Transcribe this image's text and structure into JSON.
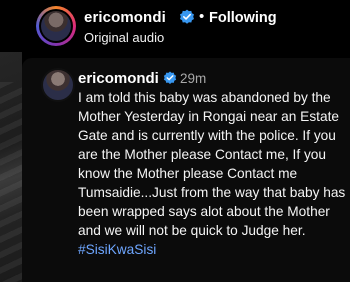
{
  "header": {
    "username": "ericomondi",
    "dot": "•",
    "follow_status": "Following",
    "audio_label": "Original audio"
  },
  "comment": {
    "username": "ericomondi",
    "time": "29m",
    "text": "I am told this baby was abandoned by the Mother Yesterday in Rongai near an Estate Gate and is currently with the police. If you are the Mother please Contact me, If you know the Mother please Contact me Tumsaidie...Just from the way that baby has been wrapped says alot about the Mother and we will not be quick to Judge her.",
    "hashtag": "#SisiKwaSisi"
  },
  "colors": {
    "background": "#000000",
    "verified_badge": "#3897f0",
    "hashtag": "#6ea6ff",
    "muted_text": "#a8a8a8"
  },
  "icons": {
    "verified": "verified-badge-icon"
  }
}
